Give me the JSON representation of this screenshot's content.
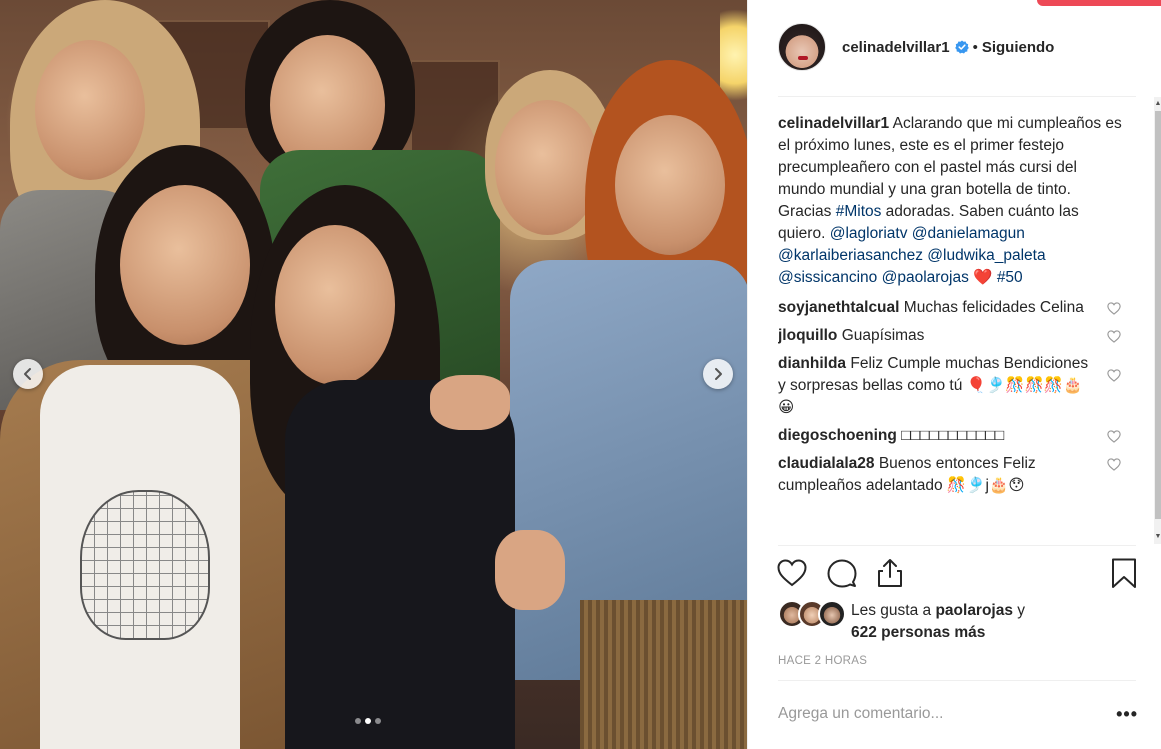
{
  "post": {
    "username": "celinadelvillar1",
    "separator": "•",
    "follow_status": "Siguiendo",
    "verified_icon": "verified-badge-icon"
  },
  "caption": {
    "username": "celinadelvillar1",
    "text_1": " Aclarando que mi cumpleaños es el próximo lunes, este es el primer festejo precumpleañero con el pastel más cursi del mundo mundial y una gran botella de tinto. Gracias ",
    "hashtag_mitos": "#Mitos",
    "text_2": " adoradas. Saben cuánto las quiero. ",
    "mention_1": "@lagloriatv",
    "mention_2": "@danielamagun",
    "mention_3": "@karlaiberiasanchez",
    "mention_4": "@ludwika_paleta",
    "mention_5": "@sissicancino",
    "mention_6": "@paolarojas",
    "emoji": "❤️",
    "hashtag_50": "#50"
  },
  "comments": [
    {
      "user": "soyjanethtalcual",
      "text": "Muchas felicidades Celina"
    },
    {
      "user": "jloquillo",
      "text": "Guapísimas"
    },
    {
      "user": "dianhilda",
      "text": "Feliz Cumple muchas Bendiciones y sorpresas bellas como tú 🎈🎐🎊🎊🎊🎂😀"
    },
    {
      "user": "diegoschoening",
      "text": "□□□□□□□□□□□"
    },
    {
      "user": "claudialala28",
      "text": "Buenos entonces Feliz cumpleaños adelantado 🎊🎐j🎂😯"
    }
  ],
  "likes": {
    "prefix": "Les gusta a ",
    "user": "paolarojas",
    "suffix": " y",
    "others": "622 personas más"
  },
  "timestamp": "HACE 2 HORAS",
  "comment_input": {
    "placeholder": "Agrega un comentario..."
  },
  "more_options": "•••",
  "carousel": {
    "total": 3,
    "active_index": 1
  },
  "colors": {
    "accent": "#ed4956",
    "link": "#003569",
    "verified": "#3897f0"
  }
}
